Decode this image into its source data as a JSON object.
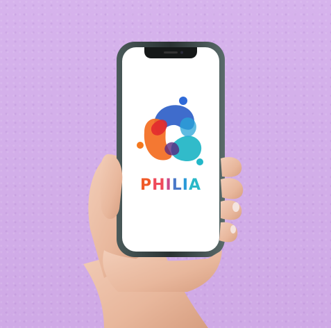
{
  "scene": {
    "background_color": "#d3b0e9",
    "subject": "hand-holding-phone"
  },
  "app": {
    "logo_icon": "philia-people-circle-logo",
    "brand_name_letters": [
      {
        "char": "P",
        "color": "#f05a28"
      },
      {
        "char": "H",
        "color": "#ef4a5a"
      },
      {
        "char": "I",
        "color": "#c84a8a"
      },
      {
        "char": "L",
        "color": "#4a78c8"
      },
      {
        "char": "I",
        "color": "#2a9ad8"
      },
      {
        "char": "A",
        "color": "#2ab8c8"
      }
    ]
  },
  "colors": {
    "orange": "#f47a1f",
    "red": "#e8322a",
    "blue": "#2f5fc8",
    "teal": "#22b7c8",
    "purple": "#7c3a9a"
  }
}
